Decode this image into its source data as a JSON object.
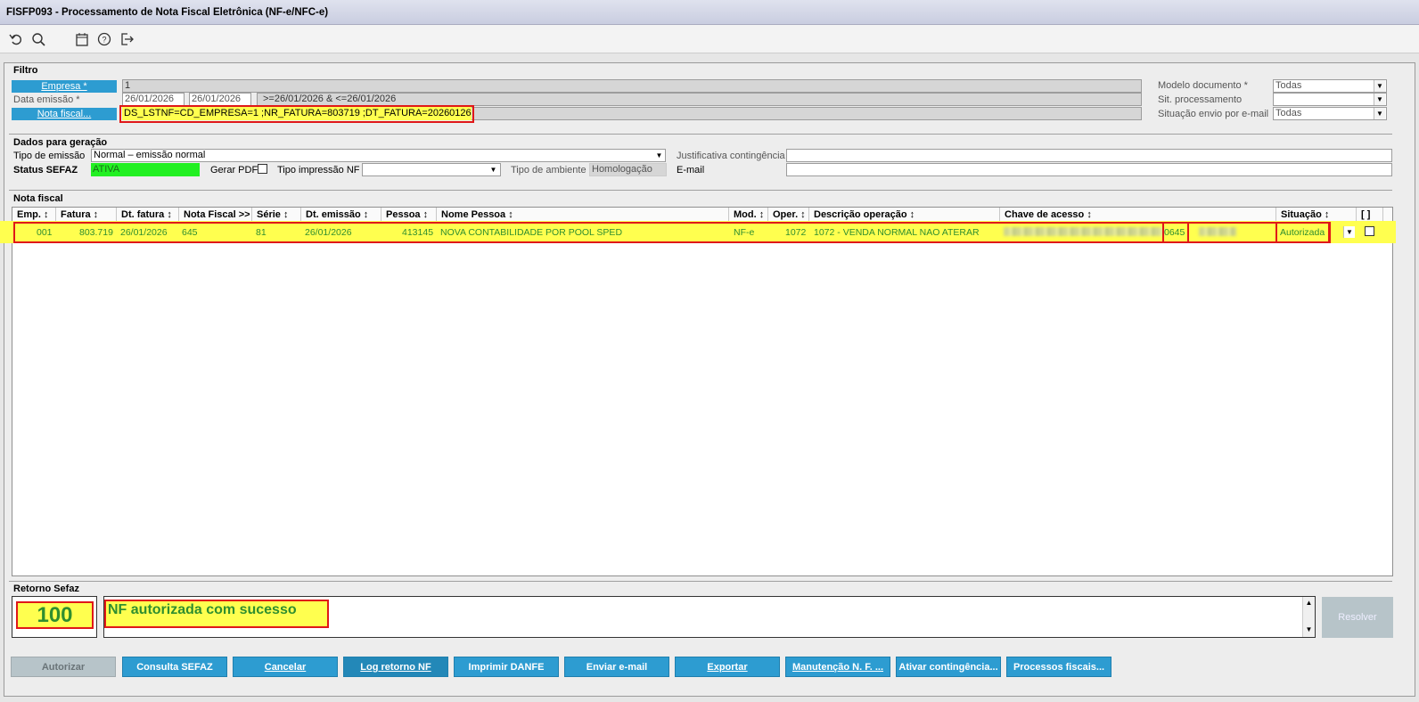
{
  "window": {
    "title": "FISFP093 - Processamento de Nota Fiscal Eletrônica (NF-e/NFC-e)"
  },
  "toolbar": {
    "icons": [
      "undo-icon",
      "search-icon",
      "calendar-icon",
      "help-icon",
      "exit-icon"
    ]
  },
  "filtro": {
    "title": "Filtro",
    "empresa_label": "Empresa *",
    "empresa_value": "1",
    "data_label": "Data emissão *",
    "data_ini": "26/01/2026",
    "data_fim": "26/01/2026",
    "data_expr": ">=26/01/2026 & <=26/01/2026",
    "nota_label": "Nota fiscal...",
    "nota_value": "DS_LSTNF=CD_EMPRESA=1 ;NR_FATURA=803719 ;DT_FATURA=20260126",
    "modelo_label": "Modelo documento *",
    "modelo_value": "Todas",
    "sit_label": "Sit. processamento",
    "sit_value": "",
    "envio_label": "Situação envio por e-mail",
    "envio_value": "Todas"
  },
  "dados": {
    "title": "Dados para geração",
    "tipo_emissao_label": "Tipo de emissão",
    "tipo_emissao_value": "Normal – emissão normal",
    "status_label": "Status SEFAZ",
    "status_value": "ATIVA",
    "gerar_pdf_label": "Gerar PDF",
    "tipo_impressao_label": "Tipo impressão NF",
    "tipo_impressao_value": "",
    "tipo_ambiente_label": "Tipo de ambiente",
    "tipo_ambiente_value": "Homologação",
    "justificativa_label": "Justificativa contingência",
    "email_label": "E-mail"
  },
  "nota": {
    "title": "Nota fiscal",
    "columns": [
      "Emp. ↕",
      "Fatura ↕",
      "Dt. fatura ↕",
      "Nota Fiscal >>",
      "Série ↕",
      "Dt. emissão ↕",
      "Pessoa ↕",
      "Nome Pessoa ↕",
      "Mod. ↕",
      "Oper. ↕",
      "Descrição operação ↕",
      "Chave de acesso ↕",
      "Situação ↕",
      "[ ]"
    ],
    "row": {
      "emp": "001",
      "fatura": "803.719",
      "dt_fatura": "26/01/2026",
      "nota": "645",
      "serie": "81",
      "dt_emissao": "26/01/2026",
      "pessoa": "413145",
      "nome": "NOVA CONTABILIDADE POR POOL SPED",
      "mod": "NF-e",
      "oper": "1072",
      "descricao": "1072 - VENDA NORMAL NAO ATERAR",
      "chave_visible": "0645",
      "situacao": "Autorizada"
    }
  },
  "retorno": {
    "title": "Retorno Sefaz",
    "code": "100",
    "message": "NF autorizada com sucesso",
    "resolver": "Resolver"
  },
  "buttons": [
    "Autorizar",
    "Consulta SEFAZ",
    "Cancelar",
    "Log retorno NF",
    "Imprimir DANFE",
    "Enviar e-mail",
    "Exportar",
    "Manutenção N. F. ...",
    "Ativar contingência...",
    "Processos fiscais..."
  ],
  "colors": {
    "accent": "#2d9cd1",
    "highlight": "#ffff4f",
    "status_green": "#22f022",
    "row_text": "#2f8e2f",
    "annot": "#e01818"
  }
}
